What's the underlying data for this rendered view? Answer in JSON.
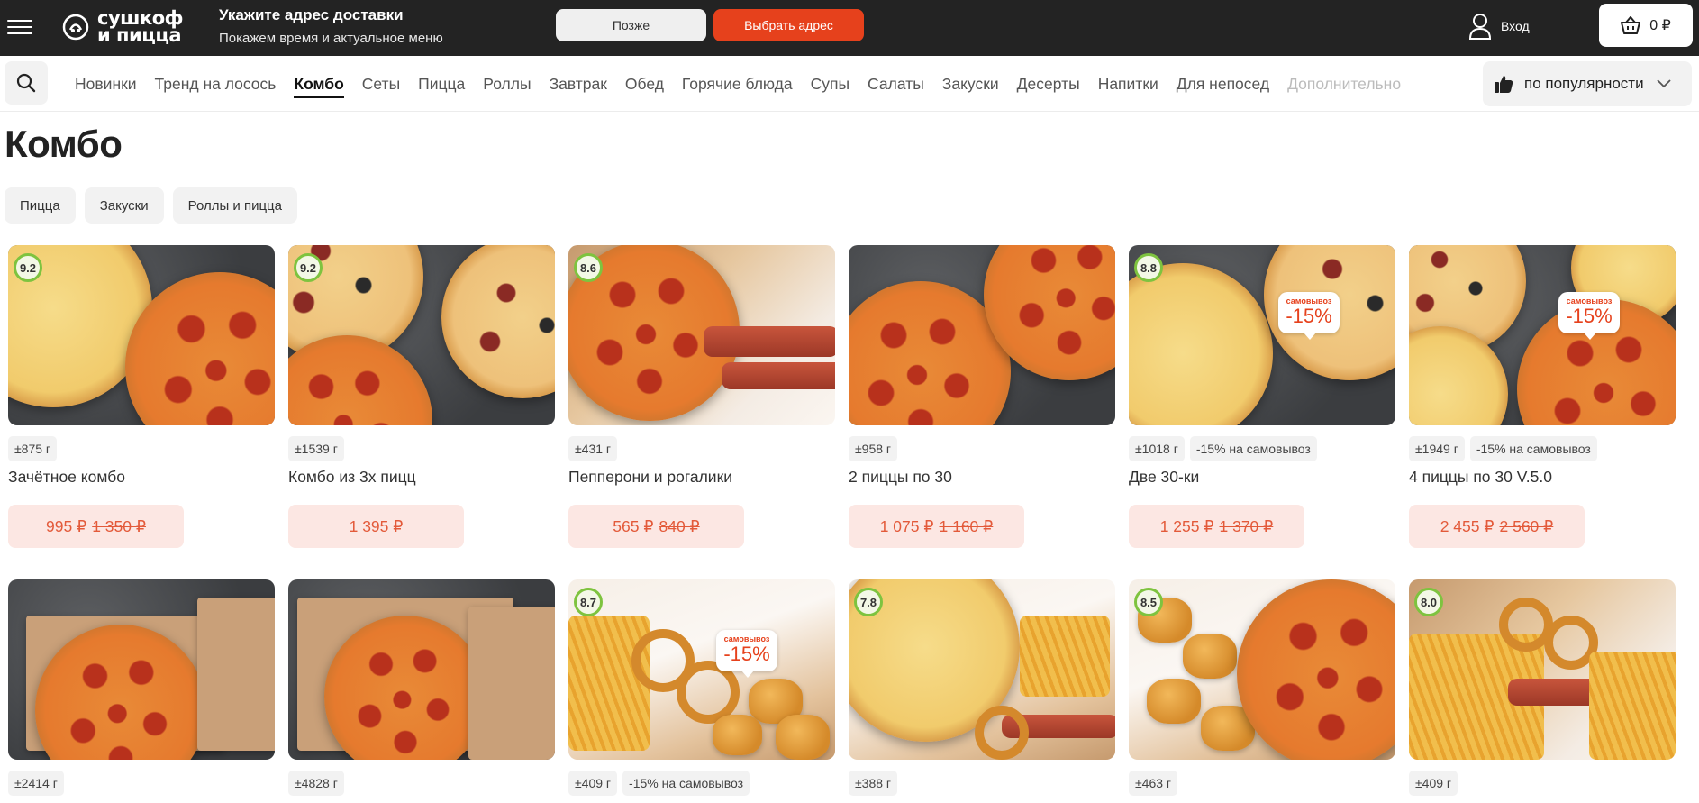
{
  "header": {
    "logo_line1": "сушкоф",
    "logo_line2": "и пицца",
    "address_title": "Укажите адрес доставки",
    "address_subtitle": "Покажем время и актуальное меню",
    "later_label": "Позже",
    "choose_address_label": "Выбрать адрес",
    "login_label": "Вход",
    "cart_total": "0 ₽",
    "accent_color": "#e6411c"
  },
  "nav": {
    "categories": [
      "Новинки",
      "Тренд на лосось",
      "Комбо",
      "Сеты",
      "Пицца",
      "Роллы",
      "Завтрак",
      "Обед",
      "Горячие блюда",
      "Супы",
      "Салаты",
      "Закуски",
      "Десерты",
      "Напитки",
      "Для непосед",
      "Дополнительно"
    ],
    "active_category": "Комбо",
    "sort_label": "по популярности"
  },
  "page": {
    "title": "Комбо",
    "filters": [
      "Пицца",
      "Закуски",
      "Роллы и пицца"
    ]
  },
  "products": [
    {
      "rating": "9.2",
      "weight": "±875 г",
      "promo_tag": "",
      "name": "Зачётное комбо",
      "price": "995 ₽",
      "old_price": "1 350 ₽",
      "promo_badge": ""
    },
    {
      "rating": "9.2",
      "weight": "±1539 г",
      "promo_tag": "",
      "name": "Комбо из 3х пицц",
      "price": "1 395 ₽",
      "old_price": "",
      "promo_badge": ""
    },
    {
      "rating": "8.6",
      "weight": "±431 г",
      "promo_tag": "",
      "name": "Пепперони и рогалики",
      "price": "565 ₽",
      "old_price": "840 ₽",
      "promo_badge": ""
    },
    {
      "rating": "",
      "weight": "±958 г",
      "promo_tag": "",
      "name": "2 пиццы по 30",
      "price": "1 075 ₽",
      "old_price": "1 160 ₽",
      "promo_badge": ""
    },
    {
      "rating": "8.8",
      "weight": "±1018 г",
      "promo_tag": "-15% на самовывоз",
      "name": "Две 30-ки",
      "price": "1 255 ₽",
      "old_price": "1 370 ₽",
      "promo_badge": "-15%"
    },
    {
      "rating": "",
      "weight": "±1949 г",
      "promo_tag": "-15% на самовывоз",
      "name": "4 пиццы по 30 V.5.0",
      "price": "2 455 ₽",
      "old_price": "2 560 ₽",
      "promo_badge": "-15%"
    },
    {
      "rating": "",
      "weight": "±2414 г",
      "promo_tag": "",
      "name": "",
      "price": "",
      "old_price": "",
      "promo_badge": ""
    },
    {
      "rating": "",
      "weight": "±4828 г",
      "promo_tag": "",
      "name": "",
      "price": "",
      "old_price": "",
      "promo_badge": ""
    },
    {
      "rating": "8.7",
      "weight": "±409 г",
      "promo_tag": "-15% на самовывоз",
      "name": "",
      "price": "",
      "old_price": "",
      "promo_badge": "-15%"
    },
    {
      "rating": "7.8",
      "weight": "±388 г",
      "promo_tag": "",
      "name": "",
      "price": "",
      "old_price": "",
      "promo_badge": ""
    },
    {
      "rating": "8.5",
      "weight": "±463 г",
      "promo_tag": "",
      "name": "",
      "price": "",
      "old_price": "",
      "promo_badge": ""
    },
    {
      "rating": "8.0",
      "weight": "±409 г",
      "promo_tag": "",
      "name": "",
      "price": "",
      "old_price": "",
      "promo_badge": ""
    }
  ],
  "promo_badge_caption": "самовывоз"
}
